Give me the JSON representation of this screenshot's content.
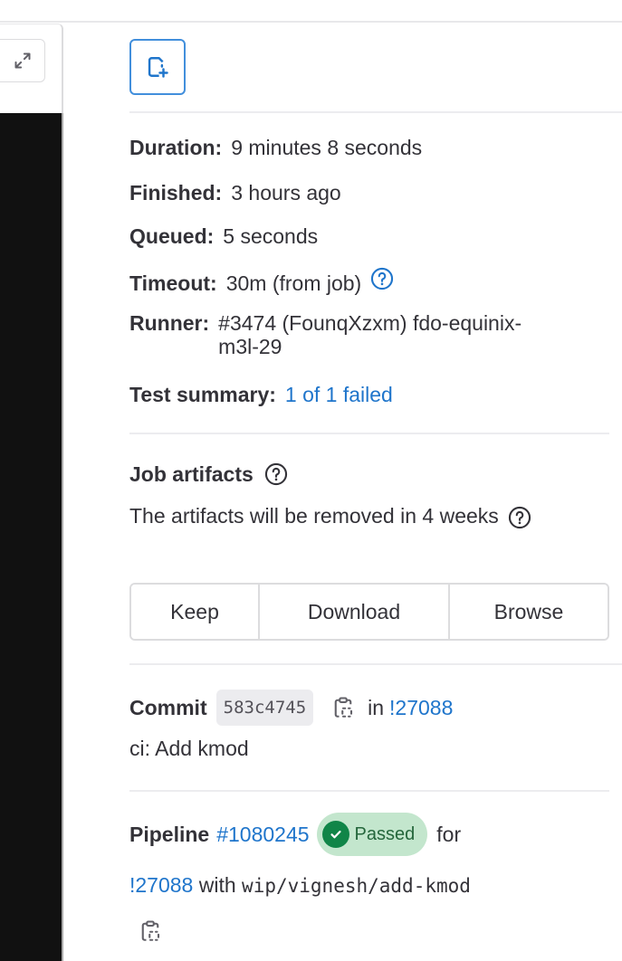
{
  "log_panel": {
    "expand_icon": "expand-arrows-icon"
  },
  "sidebar": {
    "new_issue_icon": "issue-new-icon",
    "details": [
      {
        "label": "Duration:",
        "value": "9 minutes 8 seconds"
      },
      {
        "label": "Finished:",
        "value": "3 hours ago"
      },
      {
        "label": "Queued:",
        "value": "5 seconds"
      },
      {
        "label": "Timeout:",
        "value": "30m (from job)",
        "help_icon": "question-circle-icon"
      },
      {
        "label": "Runner:",
        "value": "#3474 (FounqXzxm) fdo-equinix-m3l-29"
      },
      {
        "label": "Test summary:",
        "value": "1 of 1 failed"
      }
    ],
    "artifacts": {
      "title": "Job artifacts",
      "description": "The artifacts will be removed in 4 weeks",
      "buttons": [
        "Keep",
        "Download",
        "Browse"
      ]
    },
    "commit": {
      "label": "Commit",
      "sha": "583c4745",
      "in_text": "in",
      "mr_link": "!27088",
      "message": "ci: Add kmod"
    },
    "pipeline": {
      "label": "Pipeline",
      "id_link": "#1080245",
      "status": "Passed",
      "status_color": "#108548",
      "for_text": "for",
      "mr_link": "!27088",
      "with_text": "with",
      "branch": "wip/vignesh/add-kmod"
    }
  },
  "colors": {
    "link": "#1f75cb",
    "badge_bg": "#c3e6cd",
    "log_bg": "#111111"
  }
}
